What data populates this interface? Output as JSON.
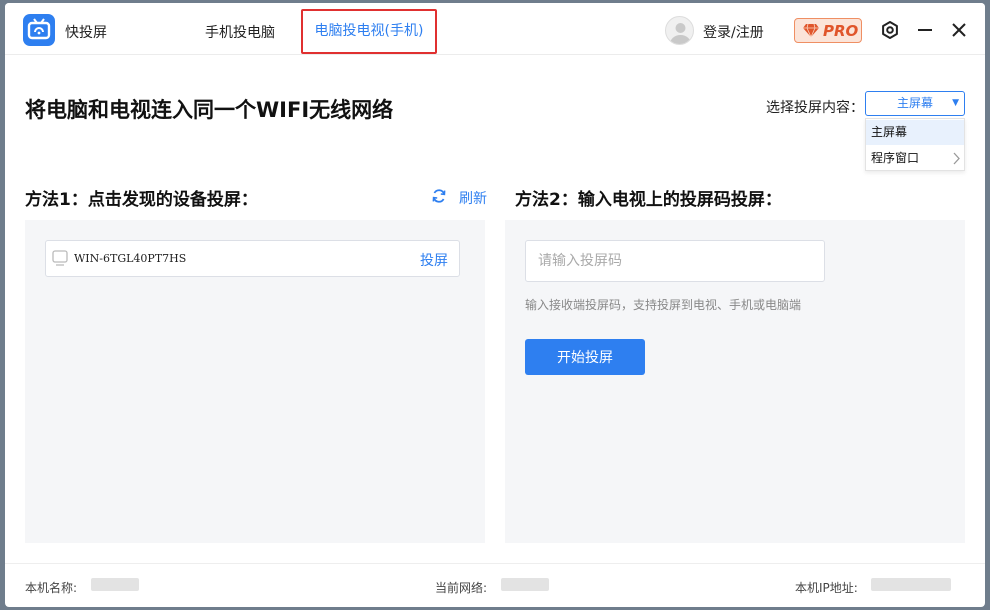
{
  "app": {
    "name": "快投屏",
    "brand_color": "#2e7ff0",
    "icons": {
      "logo": "tv-cast-icon",
      "avatar": "user-avatar-icon",
      "pro": "diamond-icon",
      "settings": "gear-icon",
      "minimize": "minimize-icon",
      "close": "close-icon"
    }
  },
  "tabs": [
    {
      "label": "手机投电脑",
      "active": false
    },
    {
      "label": "电脑投电视(手机)",
      "active": true
    }
  ],
  "header": {
    "login_label": "登录/注册",
    "pro_label": "PRO"
  },
  "headline": "将电脑和电视连入同一个WIFI无线网络",
  "content_select": {
    "label": "选择投屏内容：",
    "value": "主屏幕",
    "options": [
      "主屏幕",
      "程序窗口"
    ]
  },
  "method1": {
    "title": "方法1：点击发现的设备投屏：",
    "refresh_label": "刷新",
    "devices": [
      {
        "name": "WIN-6TGL40PT7HS",
        "action": "投屏"
      }
    ]
  },
  "method2": {
    "title": "方法2：输入电视上的投屏码投屏：",
    "code_placeholder": "请输入投屏码",
    "code_value": "",
    "hint": "输入接收端投屏码，支持投屏到电视、手机或电脑端",
    "start_label": "开始投屏"
  },
  "footer": {
    "device_name_label": "本机名称:",
    "network_label": "当前网络:",
    "ip_label": "本机IP地址:"
  }
}
